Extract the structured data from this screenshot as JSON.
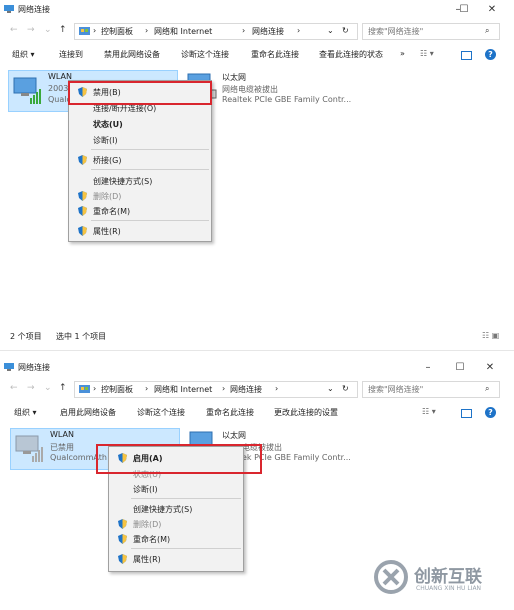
{
  "top": {
    "title": "网络连接",
    "window_controls": [
      "–",
      "☐",
      "✕"
    ],
    "breadcrumb": [
      "控制面板",
      "网络和 Internet",
      "网络连接"
    ],
    "search_placeholder": "搜索\"网络连接\"",
    "toolbar": [
      "组织 ▾",
      "连接到",
      "禁用此网络设备",
      "诊断这个连接",
      "重命名此连接",
      "查看此连接的状态",
      "»"
    ],
    "adapters": [
      {
        "name": "WLAN",
        "line1": "2003",
        "line2": "Qualc"
      },
      {
        "name": "以太网",
        "line1": "网络电缆被拔出",
        "line2": "Realtek PCIe GBE Family Contr..."
      }
    ],
    "menu": [
      {
        "label": "禁用(B)",
        "shield": true,
        "bold": false,
        "disabled": false
      },
      {
        "label": "连接/断开连接(O)",
        "shield": false,
        "bold": false,
        "disabled": false
      },
      {
        "label": "状态(U)",
        "shield": false,
        "bold": true,
        "disabled": false
      },
      {
        "label": "诊断(I)",
        "shield": false,
        "bold": false,
        "disabled": false
      },
      {
        "label": "桥接(G)",
        "shield": true,
        "bold": false,
        "disabled": false
      },
      {
        "label": "创建快捷方式(S)",
        "shield": false,
        "bold": false,
        "disabled": false
      },
      {
        "label": "删除(D)",
        "shield": true,
        "bold": false,
        "disabled": true
      },
      {
        "label": "重命名(M)",
        "shield": true,
        "bold": false,
        "disabled": false
      },
      {
        "label": "属性(R)",
        "shield": true,
        "bold": false,
        "disabled": false
      }
    ],
    "status": {
      "count": "2 个项目",
      "selected": "选中 1 个项目"
    }
  },
  "bottom": {
    "title": "网络连接",
    "window_controls": [
      "–",
      "☐",
      "✕"
    ],
    "breadcrumb": [
      "控制面板",
      "网络和 Internet",
      "网络连接"
    ],
    "search_placeholder": "搜索\"网络连接\"",
    "toolbar": [
      "组织 ▾",
      "启用此网络设备",
      "诊断这个连接",
      "重命名此连接",
      "更改此连接的设置"
    ],
    "adapters": [
      {
        "name": "WLAN",
        "line1": "已禁用",
        "line2": "QualcommAth"
      },
      {
        "name": "以太网",
        "line1": "电缆被拔出",
        "line2": "ek PCIe GBE Family Contr..."
      }
    ],
    "menu": [
      {
        "label": "启用(A)",
        "shield": true,
        "bold": true,
        "disabled": false
      },
      {
        "label": "状态(U)",
        "shield": false,
        "bold": false,
        "disabled": true
      },
      {
        "label": "诊断(I)",
        "shield": false,
        "bold": false,
        "disabled": false
      },
      {
        "label": "创建快捷方式(S)",
        "shield": false,
        "bold": false,
        "disabled": false
      },
      {
        "label": "删除(D)",
        "shield": true,
        "bold": false,
        "disabled": true
      },
      {
        "label": "重命名(M)",
        "shield": true,
        "bold": false,
        "disabled": false
      },
      {
        "label": "属性(R)",
        "shield": true,
        "bold": false,
        "disabled": false
      }
    ]
  },
  "watermark": {
    "cn": "创新互联",
    "en": "CHUANG XIN HU LIAN"
  },
  "colors": {
    "highlight_red": "#d9262e",
    "selection": "#cce8ff",
    "accent_blue": "#1e73c8"
  }
}
